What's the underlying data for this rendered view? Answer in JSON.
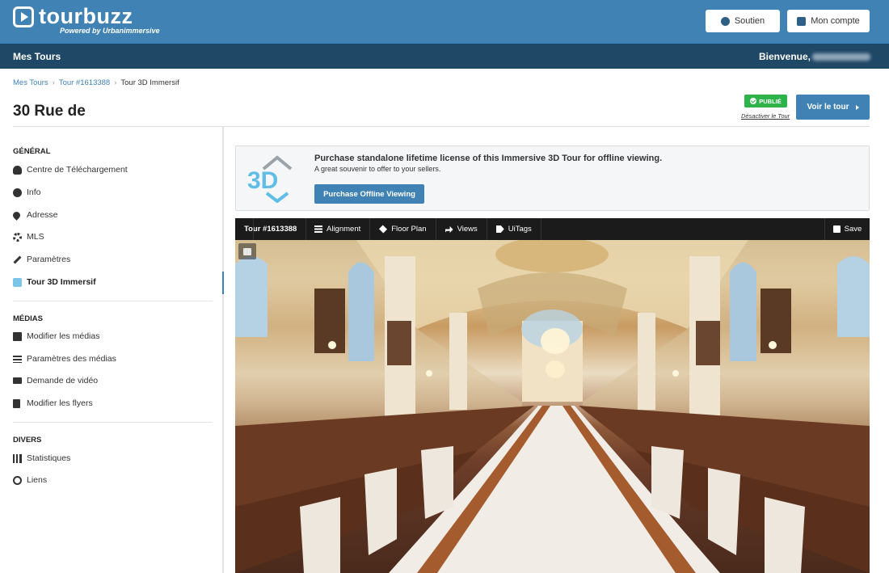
{
  "brand": {
    "name": "tourbuzz",
    "tagline": "Powered by Urbanimmersive"
  },
  "header": {
    "support_label": "Soutien",
    "account_label": "Mon compte"
  },
  "nav": {
    "title": "Mes Tours",
    "welcome": "Bienvenue,"
  },
  "breadcrumb": [
    "Mes Tours",
    "Tour #1613388",
    "Tour 3D Immersif"
  ],
  "page": {
    "title": "30 Rue de",
    "status_badge": "PUBLIÉ",
    "deactivate_link": "Désactiver le Tour",
    "view_tour_label": "Voir le tour"
  },
  "sidebar": {
    "sections": [
      {
        "title": "GÉNÉRAL",
        "items": [
          {
            "label": "Centre de Téléchargement",
            "icon": "cloud-download-icon"
          },
          {
            "label": "Info",
            "icon": "info-icon"
          },
          {
            "label": "Adresse",
            "icon": "map-pin-icon"
          },
          {
            "label": "MLS",
            "icon": "gear-icon"
          },
          {
            "label": "Paramètres",
            "icon": "wrench-icon"
          },
          {
            "label": "Tour 3D Immersif",
            "icon": "3d-tour-icon",
            "active": true
          }
        ]
      },
      {
        "title": "MÉDIAS",
        "items": [
          {
            "label": "Modifier les médias",
            "icon": "image-icon"
          },
          {
            "label": "Paramètres des médias",
            "icon": "sliders-icon"
          },
          {
            "label": "Demande de vidéo",
            "icon": "video-camera-icon"
          },
          {
            "label": "Modifier les flyers",
            "icon": "file-icon"
          }
        ]
      },
      {
        "title": "DIVERS",
        "items": [
          {
            "label": "Statistiques",
            "icon": "bar-chart-icon"
          },
          {
            "label": "Liens",
            "icon": "link-icon"
          }
        ]
      }
    ]
  },
  "promo": {
    "logo_text": "3D",
    "title": "Purchase standalone lifetime license of this Immersive 3D Tour for offline viewing.",
    "subtitle": "A great souvenir to offer to your sellers.",
    "button_label": "Purchase Offline Viewing"
  },
  "toolbar": {
    "tour_id": "Tour #1613388",
    "items": [
      {
        "label": "Alignment",
        "icon": "list-icon"
      },
      {
        "label": "Floor Plan",
        "icon": "layers-icon"
      },
      {
        "label": "Views",
        "icon": "share-arrow-icon"
      },
      {
        "label": "UiTags",
        "icon": "tag-icon"
      }
    ],
    "save_label": "Save"
  },
  "colors": {
    "primary": "#3f82b3",
    "navbar": "#1f4766",
    "badge_green": "#2db34a",
    "toolbar_bg": "#1b1b1b"
  }
}
